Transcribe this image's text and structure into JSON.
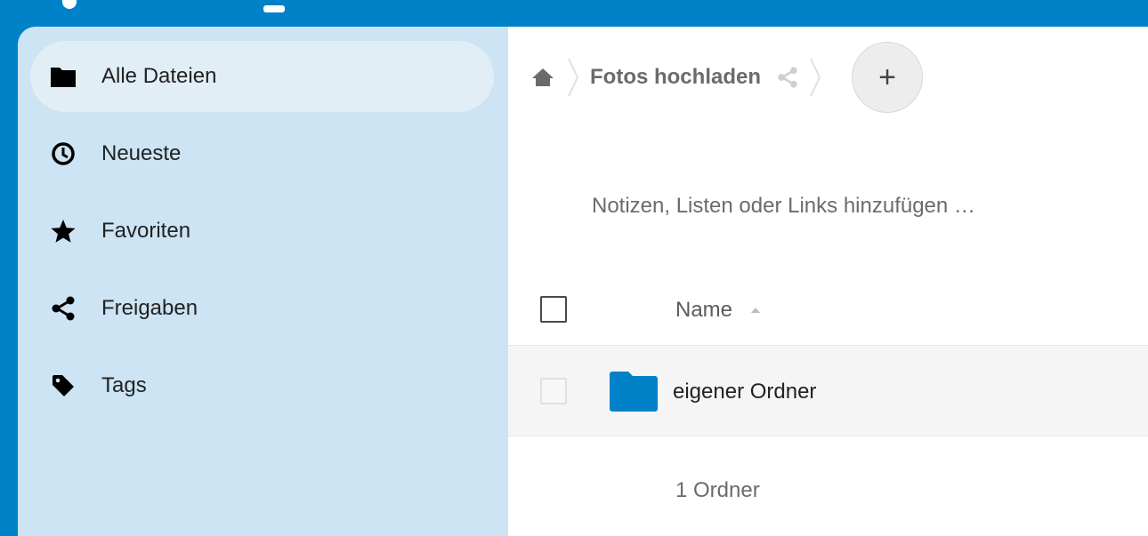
{
  "colors": {
    "brand": "#0082c9",
    "sidebar_bg": "#cce4f3",
    "sidebar_active_bg": "#e2eef6",
    "folder": "#0082c9"
  },
  "sidebar": {
    "items": [
      {
        "label": "Alle Dateien",
        "icon": "folder-icon",
        "active": true
      },
      {
        "label": "Neueste",
        "icon": "clock-icon",
        "active": false
      },
      {
        "label": "Favoriten",
        "icon": "star-icon",
        "active": false
      },
      {
        "label": "Freigaben",
        "icon": "share-icon",
        "active": false
      },
      {
        "label": "Tags",
        "icon": "tag-icon",
        "active": false
      }
    ]
  },
  "breadcrumb": {
    "home_icon": "home-icon",
    "current_folder": "Fotos hochladen",
    "share_icon": "share-icon",
    "new_button_label": "+"
  },
  "notes": {
    "placeholder": "Notizen, Listen oder Links hinzufügen …"
  },
  "file_list": {
    "columns": {
      "name": "Name",
      "sort_icon": "sort-ascending-icon"
    },
    "rows": [
      {
        "name": "eigener Ordner",
        "icon": "folder-icon"
      }
    ],
    "summary": "1 Ordner"
  }
}
